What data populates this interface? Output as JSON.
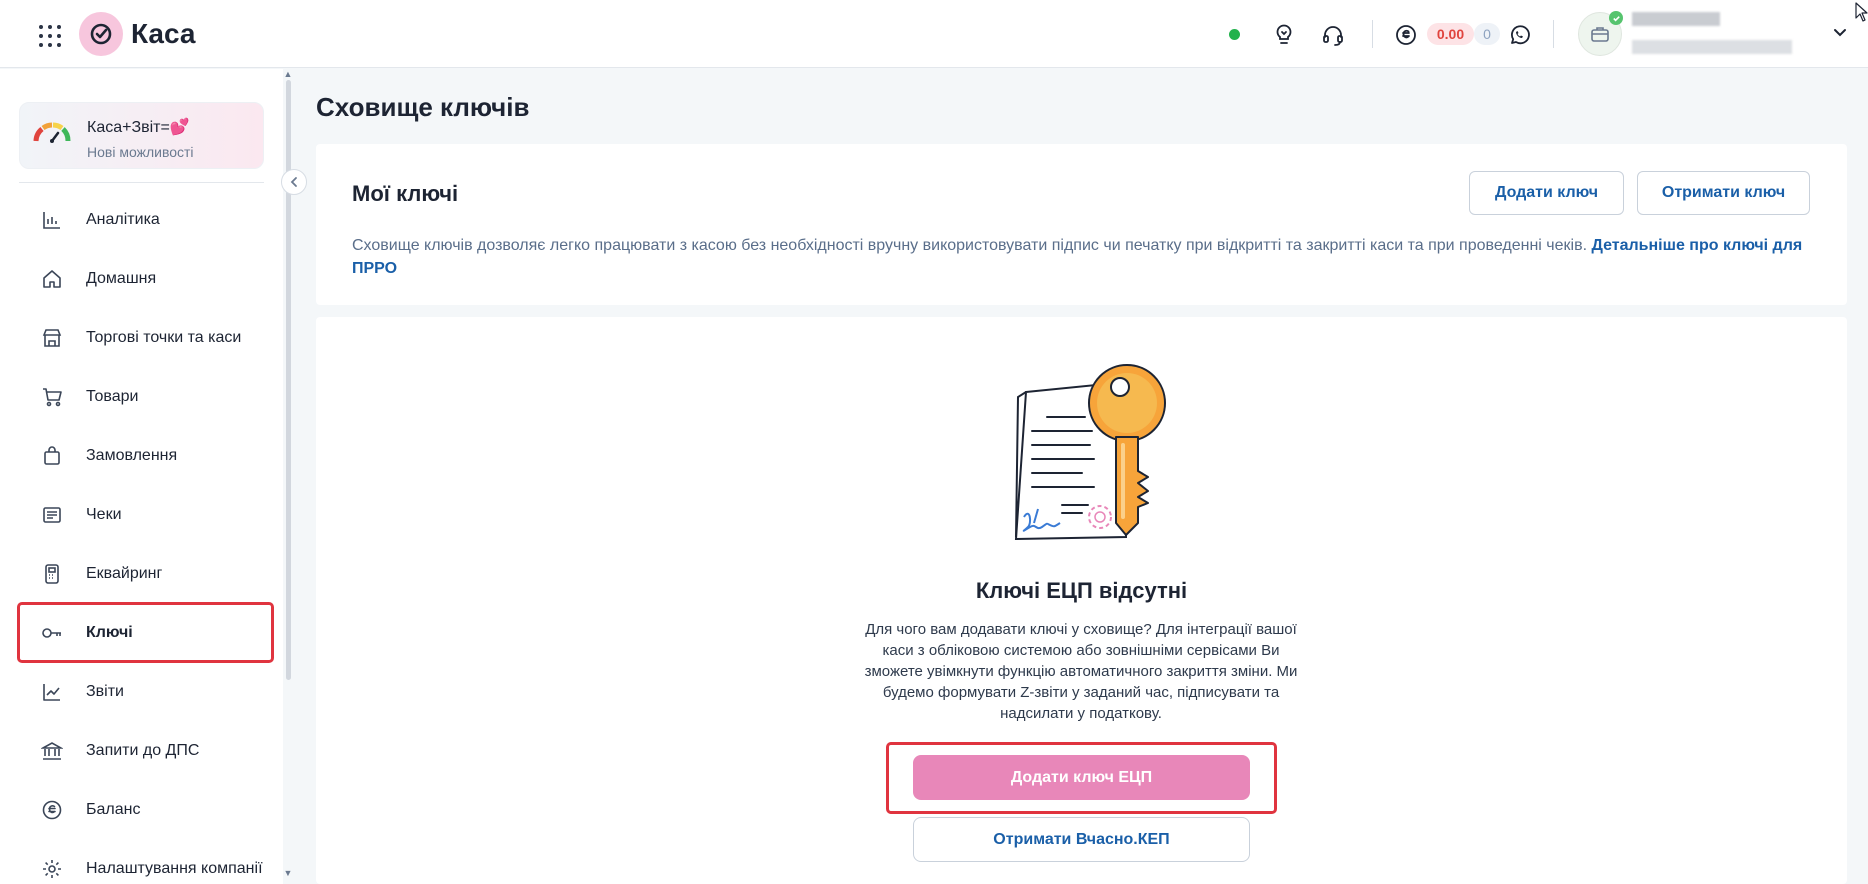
{
  "header": {
    "app_name": "Каса",
    "balance_amount": "0.00",
    "balance_count": "0",
    "icons": [
      "apps-grid-icon",
      "kasa-logo-icon",
      "online-status-icon",
      "lightbulb-icon",
      "headset-icon",
      "currency-icon",
      "whatsapp-icon",
      "company-briefcase-icon",
      "chevron-down-icon"
    ]
  },
  "sidebar": {
    "promo_title": "Каса+Звіт=💕",
    "promo_subtitle": "Нові можливості",
    "items": [
      {
        "label": "Аналітика",
        "icon": "analytics-icon"
      },
      {
        "label": "Домашня",
        "icon": "home-icon"
      },
      {
        "label": "Торгові точки та каси",
        "icon": "store-icon"
      },
      {
        "label": "Товари",
        "icon": "cart-icon"
      },
      {
        "label": "Замовлення",
        "icon": "bag-icon"
      },
      {
        "label": "Чеки",
        "icon": "receipt-icon"
      },
      {
        "label": "Еквайринг",
        "icon": "terminal-icon"
      },
      {
        "label": "Ключі",
        "icon": "key-icon",
        "active": true
      },
      {
        "label": "Звіти",
        "icon": "chart-icon"
      },
      {
        "label": "Запити до ДПС",
        "icon": "bank-icon"
      },
      {
        "label": "Баланс",
        "icon": "balance-icon"
      },
      {
        "label": "Налаштування компанії",
        "icon": "settings-icon"
      }
    ]
  },
  "main": {
    "page_title": "Сховище ключів",
    "my_keys": {
      "title": "Мої ключі",
      "add_key_label": "Додати ключ",
      "get_key_label": "Отримати ключ",
      "description": "Сховище ключів дозволяє легко працювати з касою без необхідності вручну використовувати підпис чи печатку при відкритті та закритті каси та при проведенні чеків.",
      "link_text": "Детальніше про ключі для ПРРО"
    },
    "empty_state": {
      "title": "Ключі ЕЦП відсутні",
      "description": "Для чого вам додавати ключі у сховище? Для інтеграції вашої каси з обліковою системою або зовнішніми сервісами Ви зможете увімкнути функцію автоматичного закриття зміни. Ми будемо формувати Z-звіти у заданий час, підписувати та надсилати у податкову.",
      "add_ecp_label": "Додати ключ ЕЦП",
      "get_kep_label": "Отримати Вчасно.КЕП"
    }
  },
  "colors": {
    "accent_blue": "#1a5fa8",
    "accent_pink": "#e887b9",
    "highlight_red": "#e0343f",
    "online_green": "#22b24c"
  }
}
